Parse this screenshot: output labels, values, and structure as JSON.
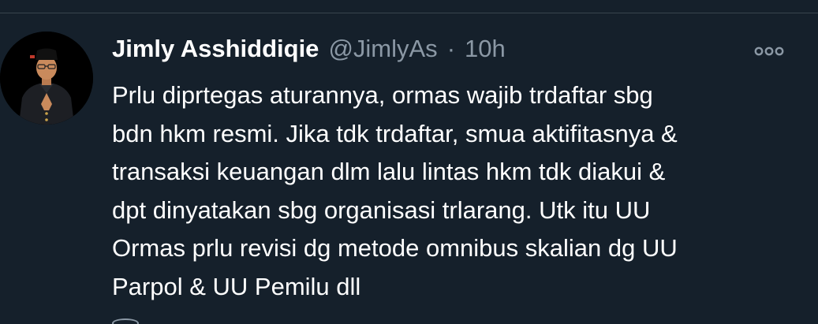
{
  "tweet": {
    "display_name": "Jimly Asshiddiqie",
    "handle": "@JimlyAs",
    "separator": "·",
    "time": "10h",
    "text": "Prlu diprtegas aturannya, ormas wajib trdaftar sbg\nbdn hkm resmi. Jika tdk trdaftar, smua aktifitasnya &\ntransaksi keuangan dlm lalu lintas hkm tdk diakui &\ndpt dinyatakan sbg organisasi trlarang. Utk itu UU\nOrmas prlu revisi dg metode omnibus skalian dg UU\nParpol & UU Pemilu dll"
  },
  "icons": {
    "more": "more-options-icon",
    "reply": "reply-icon"
  },
  "colors": {
    "background": "#15202b",
    "text_primary": "#ffffff",
    "text_secondary": "#8b98a5",
    "divider": "#38444d"
  }
}
